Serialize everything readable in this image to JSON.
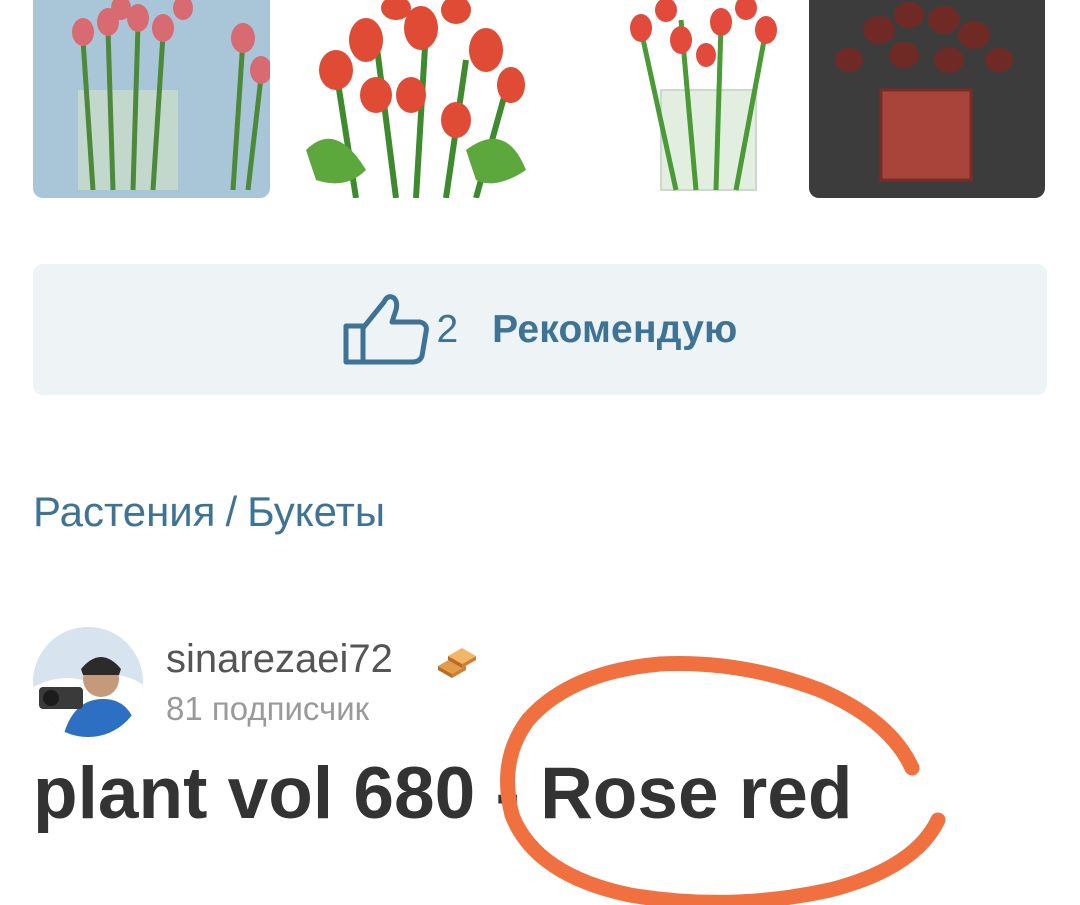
{
  "recommend": {
    "count": "2",
    "label": "Рекомендую"
  },
  "breadcrumb": {
    "category": "Растения",
    "separator": "/",
    "subcategory": "Букеты"
  },
  "author": {
    "name": "sinarezaei72",
    "subscribers": "81 подписчик"
  },
  "product": {
    "title": "plant vol 680 - Rose red"
  },
  "annotation": {
    "color": "#f07040"
  },
  "colors": {
    "link": "#3f7396",
    "button_bg": "#eef3f6",
    "title": "#333333"
  }
}
